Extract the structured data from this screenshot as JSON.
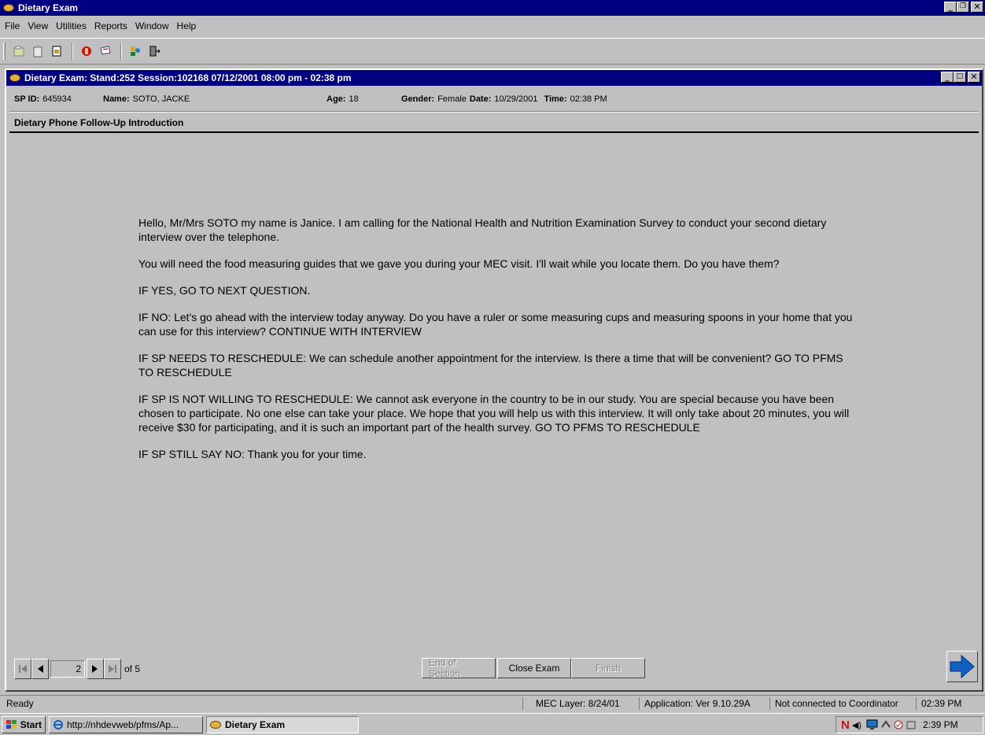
{
  "app": {
    "title": "Dietary Exam"
  },
  "menu": {
    "items": [
      "File",
      "View",
      "Utilities",
      "Reports",
      "Window",
      "Help"
    ]
  },
  "child": {
    "title": "Dietary Exam: Stand:252 Session:102168 07/12/2001 08:00 pm - 02:38 pm"
  },
  "patient": {
    "sp_id_label": "SP ID:",
    "sp_id": "645934",
    "name_label": "Name:",
    "name": "SOTO, JACKE",
    "age_label": "Age:",
    "age": "18",
    "gender_label": "Gender:",
    "gender": "Female",
    "date_label": "Date:",
    "date": "10/29/2001",
    "time_label": "Time:",
    "time": "02:38 PM"
  },
  "section": {
    "title": "Dietary Phone Follow-Up Introduction"
  },
  "script": {
    "p1": "Hello, Mr/Mrs SOTO my name is Janice.  I am calling for the National Health and Nutrition Examination Survey to conduct your second dietary interview over the telephone.",
    "p2": "You will need the food measuring guides that we gave you during your MEC visit. I'll wait while you locate them. Do you have them?",
    "p3": "IF YES, GO TO NEXT QUESTION.",
    "p4": "IF NO: Let's go ahead with the interview today anyway. Do you have a ruler or some measuring cups and measuring spoons in your home that you can use for this interview? CONTINUE WITH INTERVIEW",
    "p5": "IF SP NEEDS TO RESCHEDULE: We can schedule another appointment for the interview.  Is there a time that will be convenient? GO TO PFMS TO RESCHEDULE",
    "p6": "IF SP IS NOT WILLING TO RESCHEDULE:  We cannot ask everyone in the country to be in our study.  You are special because you have been chosen to participate.  No one else can take your place.  We hope that you will help us with this interview.  It will only take about 20 minutes, you will receive $30 for participating, and it is such an important part of the health survey. GO TO PFMS TO RESCHEDULE",
    "p7": "IF SP STILL SAY NO: Thank you for your time."
  },
  "pager": {
    "current_page": "2",
    "of_label": "of 5"
  },
  "buttons": {
    "end_of_section": "End of Section",
    "close_exam": "Close Exam",
    "finish": "Finish"
  },
  "status": {
    "ready": "Ready",
    "mec_layer": "MEC Layer: 8/24/01",
    "application": "Application: Ver 9.10.29A",
    "coordinator": "Not connected to Coordinator",
    "time": "02:39 PM"
  },
  "taskbar": {
    "start": "Start",
    "ie_task": "http://nhdevweb/pfms/Ap...",
    "app_task": "Dietary Exam",
    "clock": "2:39 PM"
  },
  "colors": {
    "titlebar": "#000080",
    "face": "#c0c0c0",
    "next_arrow": "#1060c0"
  }
}
